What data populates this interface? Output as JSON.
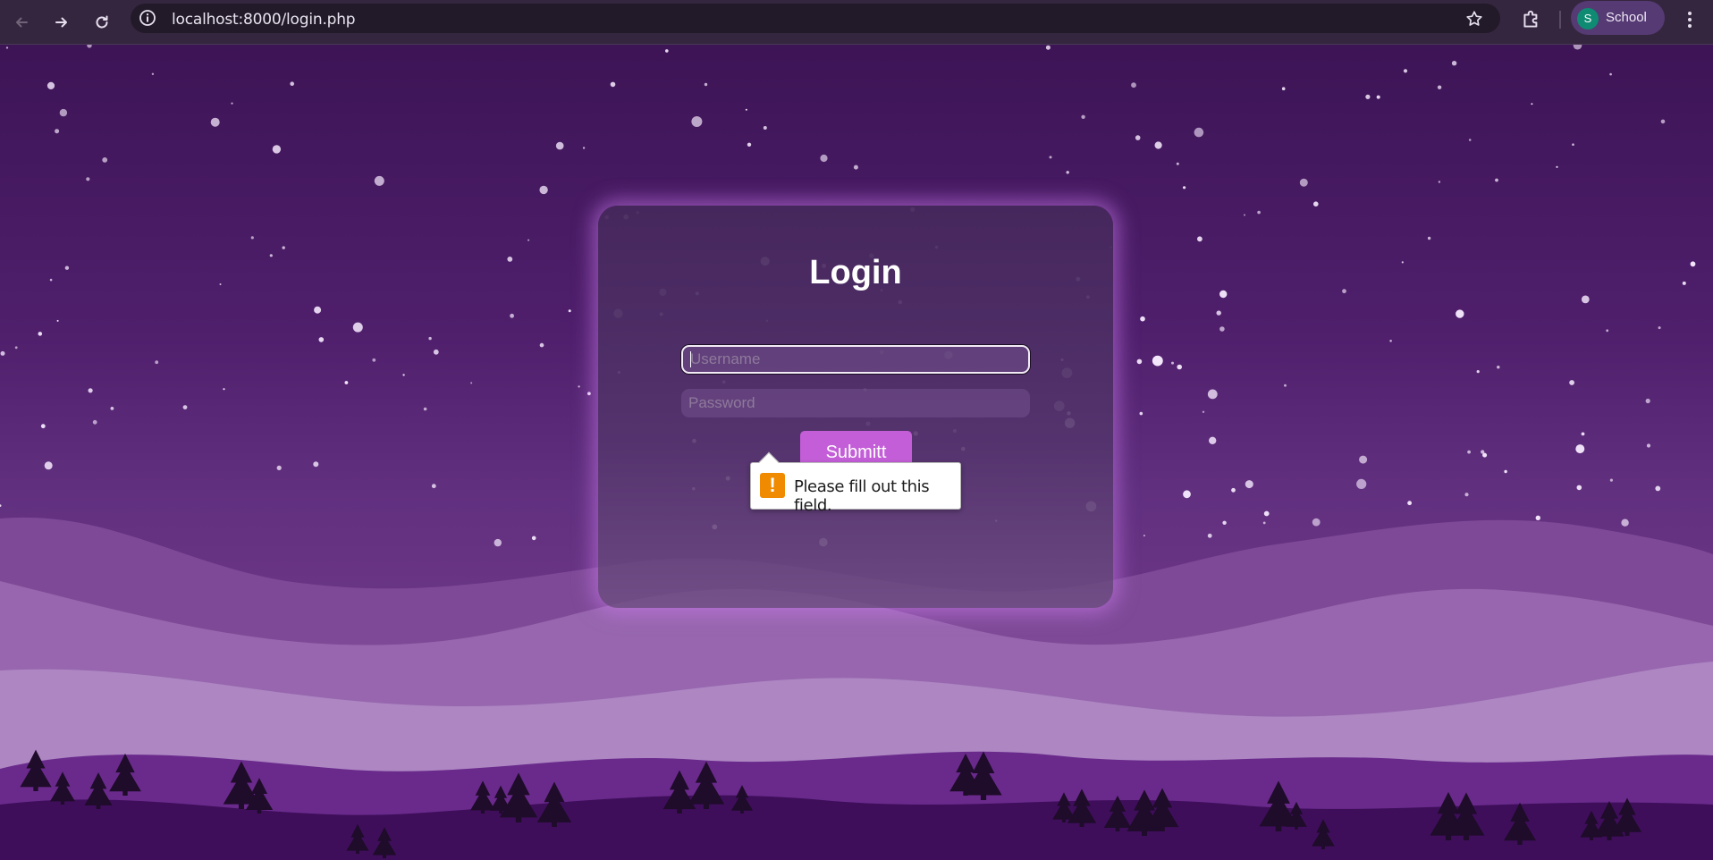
{
  "browser": {
    "url": "localhost:8000/login.php",
    "profile_initial": "S",
    "profile_name": "School"
  },
  "icons": {
    "back": "arrow-left-icon",
    "forward": "arrow-right-icon",
    "reload": "reload-icon",
    "site_info": "info-icon",
    "bookmark": "star-icon",
    "extensions": "puzzle-icon",
    "menu": "kebab-menu-icon",
    "warning": "exclamation-icon"
  },
  "login": {
    "title": "Login",
    "username_placeholder": "Username",
    "password_placeholder": "Password",
    "submit_label": "Submitt"
  },
  "validation": {
    "icon_glyph": "!",
    "message": "Please fill out this field."
  },
  "colors": {
    "sky_top": "#3d1456",
    "sky_bottom": "#6b3585",
    "button": "#c35ed8",
    "warning": "#f08a00"
  }
}
